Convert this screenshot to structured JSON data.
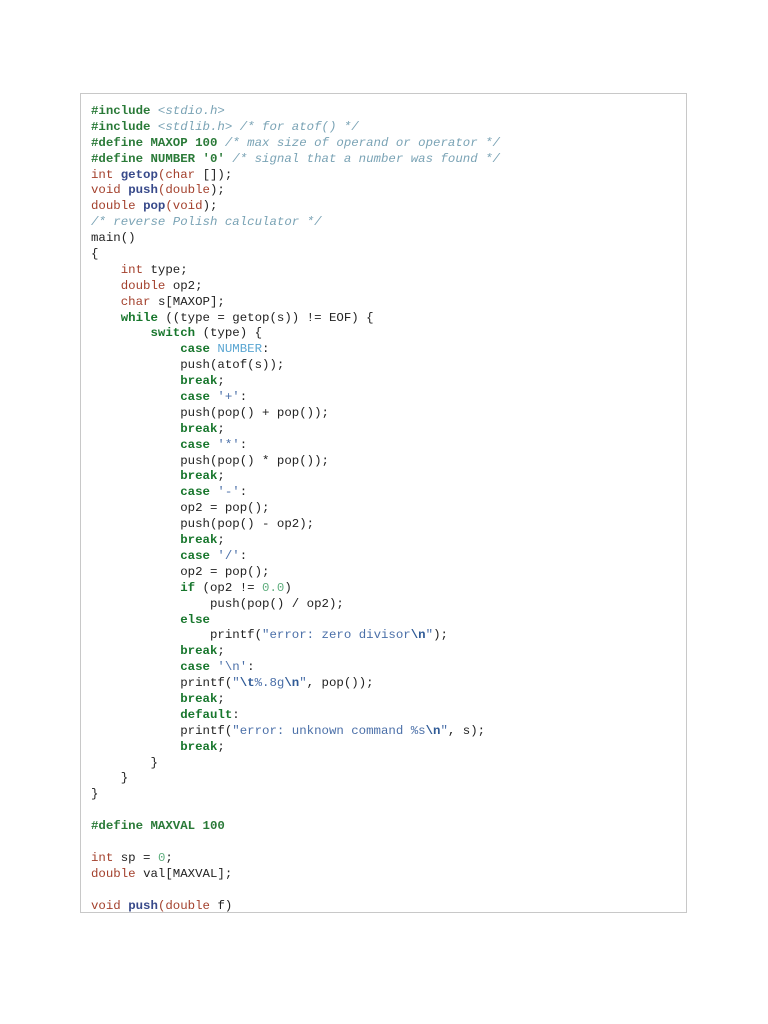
{
  "code_lines": [
    [
      [
        "pp",
        "#include "
      ],
      [
        "cm",
        "<stdio.h>"
      ]
    ],
    [
      [
        "pp",
        "#include "
      ],
      [
        "cm",
        "<stdlib.h> /* for atof() */"
      ]
    ],
    [
      [
        "pp",
        "#define MAXOP 100 "
      ],
      [
        "cm",
        "/* max size of operand or operator */"
      ]
    ],
    [
      [
        "pp",
        "#define NUMBER '0' "
      ],
      [
        "cm",
        "/* signal that a number was found */"
      ]
    ],
    [
      [
        "ty",
        "int "
      ],
      [
        "fn",
        "getop"
      ],
      [
        "ty",
        "(char "
      ],
      [
        "pl",
        "[]);"
      ]
    ],
    [
      [
        "ty",
        "void "
      ],
      [
        "fn",
        "push"
      ],
      [
        "ty",
        "(double"
      ],
      [
        "pl",
        ");"
      ]
    ],
    [
      [
        "ty",
        "double "
      ],
      [
        "fn",
        "pop"
      ],
      [
        "ty",
        "(void"
      ],
      [
        "pl",
        ");"
      ]
    ],
    [
      [
        "cm",
        "/* reverse Polish calculator */"
      ]
    ],
    [
      [
        "pl",
        "main()"
      ]
    ],
    [
      [
        "pl",
        "{"
      ]
    ],
    [
      [
        "pl",
        "    "
      ],
      [
        "ty",
        "int "
      ],
      [
        "pl",
        "type;"
      ]
    ],
    [
      [
        "pl",
        "    "
      ],
      [
        "ty",
        "double "
      ],
      [
        "pl",
        "op2;"
      ]
    ],
    [
      [
        "pl",
        "    "
      ],
      [
        "ty",
        "char "
      ],
      [
        "pl",
        "s[MAXOP];"
      ]
    ],
    [
      [
        "pl",
        "    "
      ],
      [
        "kw",
        "while "
      ],
      [
        "pl",
        "((type = getop(s)) != EOF) {"
      ]
    ],
    [
      [
        "pl",
        "        "
      ],
      [
        "kw",
        "switch "
      ],
      [
        "pl",
        "(type) {"
      ]
    ],
    [
      [
        "pl",
        "            "
      ],
      [
        "kw",
        "case "
      ],
      [
        "cn",
        "NUMBER"
      ],
      [
        "pl",
        ":"
      ]
    ],
    [
      [
        "pl",
        "            push(atof(s));"
      ]
    ],
    [
      [
        "pl",
        "            "
      ],
      [
        "kw",
        "break"
      ],
      [
        "pl",
        ";"
      ]
    ],
    [
      [
        "pl",
        "            "
      ],
      [
        "kw",
        "case "
      ],
      [
        "st",
        "'+'"
      ],
      [
        "pl",
        ":"
      ]
    ],
    [
      [
        "pl",
        "            push(pop() + pop());"
      ]
    ],
    [
      [
        "pl",
        "            "
      ],
      [
        "kw",
        "break"
      ],
      [
        "pl",
        ";"
      ]
    ],
    [
      [
        "pl",
        "            "
      ],
      [
        "kw",
        "case "
      ],
      [
        "st",
        "'*'"
      ],
      [
        "pl",
        ":"
      ]
    ],
    [
      [
        "pl",
        "            push(pop() * pop());"
      ]
    ],
    [
      [
        "pl",
        "            "
      ],
      [
        "kw",
        "break"
      ],
      [
        "pl",
        ";"
      ]
    ],
    [
      [
        "pl",
        "            "
      ],
      [
        "kw",
        "case "
      ],
      [
        "st",
        "'-'"
      ],
      [
        "pl",
        ":"
      ]
    ],
    [
      [
        "pl",
        "            op2 = pop();"
      ]
    ],
    [
      [
        "pl",
        "            push(pop() - op2);"
      ]
    ],
    [
      [
        "pl",
        "            "
      ],
      [
        "kw",
        "break"
      ],
      [
        "pl",
        ";"
      ]
    ],
    [
      [
        "pl",
        "            "
      ],
      [
        "kw",
        "case "
      ],
      [
        "st",
        "'/'"
      ],
      [
        "pl",
        ":"
      ]
    ],
    [
      [
        "pl",
        "            op2 = pop();"
      ]
    ],
    [
      [
        "pl",
        "            "
      ],
      [
        "kw",
        "if "
      ],
      [
        "pl",
        "(op2 != "
      ],
      [
        "nu",
        "0.0"
      ],
      [
        "pl",
        ")"
      ]
    ],
    [
      [
        "pl",
        "                push(pop() / op2);"
      ]
    ],
    [
      [
        "pl",
        "            "
      ],
      [
        "kw",
        "else"
      ]
    ],
    [
      [
        "pl",
        "                printf("
      ],
      [
        "st",
        "\"error: zero divisor"
      ],
      [
        "es",
        "\\n"
      ],
      [
        "st",
        "\""
      ],
      [
        "pl",
        ");"
      ]
    ],
    [
      [
        "pl",
        "            "
      ],
      [
        "kw",
        "break"
      ],
      [
        "pl",
        ";"
      ]
    ],
    [
      [
        "pl",
        "            "
      ],
      [
        "kw",
        "case "
      ],
      [
        "st",
        "'\\n'"
      ],
      [
        "pl",
        ":"
      ]
    ],
    [
      [
        "pl",
        "            printf("
      ],
      [
        "st",
        "\""
      ],
      [
        "es",
        "\\t"
      ],
      [
        "st",
        "%.8g"
      ],
      [
        "es",
        "\\n"
      ],
      [
        "st",
        "\""
      ],
      [
        "pl",
        ", pop());"
      ]
    ],
    [
      [
        "pl",
        "            "
      ],
      [
        "kw",
        "break"
      ],
      [
        "pl",
        ";"
      ]
    ],
    [
      [
        "pl",
        "            "
      ],
      [
        "kw",
        "default"
      ],
      [
        "pl",
        ":"
      ]
    ],
    [
      [
        "pl",
        "            printf("
      ],
      [
        "st",
        "\"error: unknown command %s"
      ],
      [
        "es",
        "\\n"
      ],
      [
        "st",
        "\""
      ],
      [
        "pl",
        ", s);"
      ]
    ],
    [
      [
        "pl",
        "            "
      ],
      [
        "kw",
        "break"
      ],
      [
        "pl",
        ";"
      ]
    ],
    [
      [
        "pl",
        "        }"
      ]
    ],
    [
      [
        "pl",
        "    }"
      ]
    ],
    [
      [
        "pl",
        "}"
      ]
    ],
    [],
    [
      [
        "pp",
        "#define MAXVAL 100"
      ]
    ],
    [],
    [
      [
        "ty",
        "int "
      ],
      [
        "pl",
        "sp = "
      ],
      [
        "nu",
        "0"
      ],
      [
        "pl",
        ";"
      ]
    ],
    [
      [
        "ty",
        "double "
      ],
      [
        "pl",
        "val[MAXVAL];"
      ]
    ],
    [],
    [
      [
        "ty",
        "void "
      ],
      [
        "fn",
        "push"
      ],
      [
        "ty",
        "(double "
      ],
      [
        "pl",
        "f)"
      ]
    ]
  ]
}
